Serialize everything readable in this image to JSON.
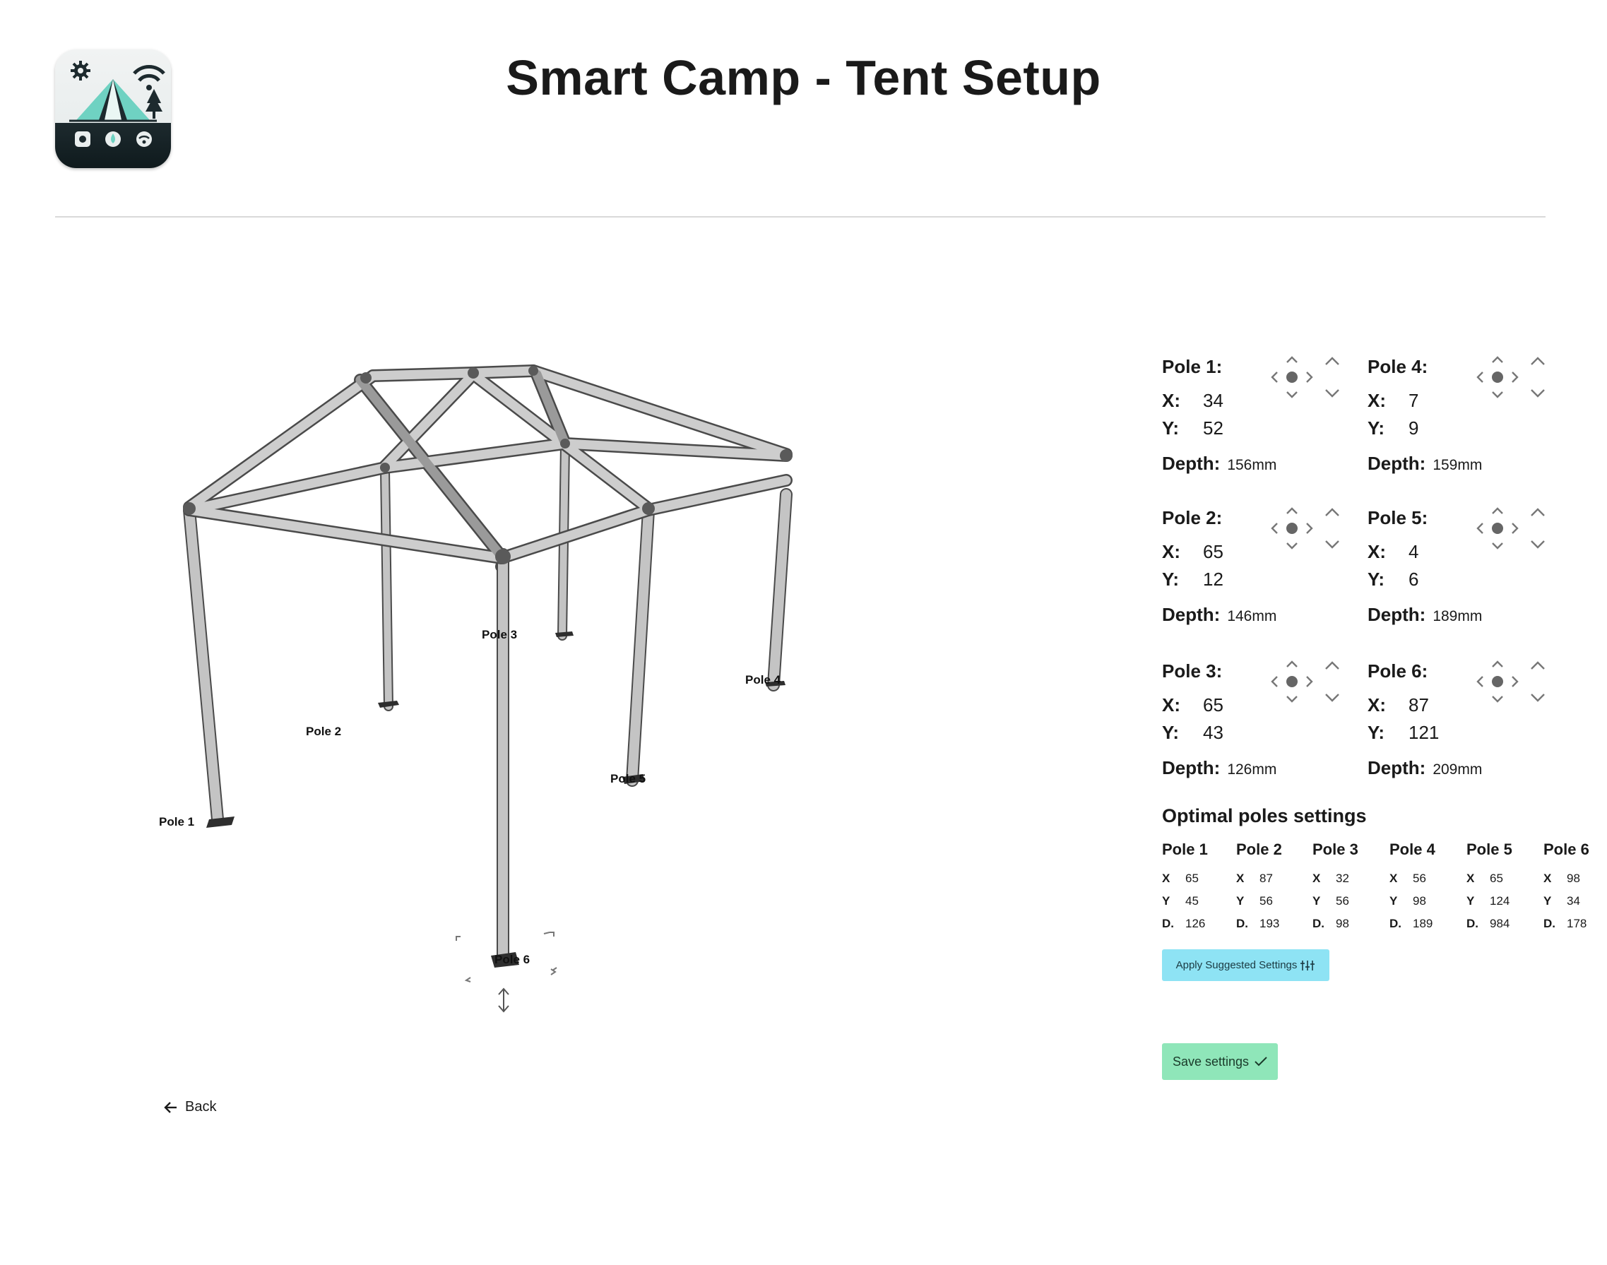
{
  "header": {
    "title": "Smart Camp - Tent Setup"
  },
  "tent_labels": [
    "Pole 1",
    "Pole 2",
    "Pole 3",
    "Pole 4",
    "Pole 5",
    "Pole 6"
  ],
  "poles": [
    {
      "name": "Pole 1:",
      "x_label": "X:",
      "x": "34",
      "y_label": "Y:",
      "y": "52",
      "depth_label": "Depth:",
      "depth": "156mm"
    },
    {
      "name": "Pole 4:",
      "x_label": "X:",
      "x": "7",
      "y_label": "Y:",
      "y": "9",
      "depth_label": "Depth:",
      "depth": "159mm"
    },
    {
      "name": "Pole 2:",
      "x_label": "X:",
      "x": "65",
      "y_label": "Y:",
      "y": "12",
      "depth_label": "Depth:",
      "depth": "146mm"
    },
    {
      "name": "Pole 5:",
      "x_label": "X:",
      "x": "4",
      "y_label": "Y:",
      "y": "6",
      "depth_label": "Depth:",
      "depth": "189mm"
    },
    {
      "name": "Pole 3:",
      "x_label": "X:",
      "x": "65",
      "y_label": "Y:",
      "y": "43",
      "depth_label": "Depth:",
      "depth": "126mm"
    },
    {
      "name": "Pole 6:",
      "x_label": "X:",
      "x": "87",
      "y_label": "Y:",
      "y": "121",
      "depth_label": "Depth:",
      "depth": "209mm"
    }
  ],
  "optimal": {
    "title": "Optimal poles settings",
    "columns": [
      {
        "name": "Pole 1",
        "x": "65",
        "y": "45",
        "d": "126"
      },
      {
        "name": "Pole 2",
        "x": "87",
        "y": "56",
        "d": "193"
      },
      {
        "name": "Pole 3",
        "x": "32",
        "y": "56",
        "d": "98"
      },
      {
        "name": "Pole 4",
        "x": "56",
        "y": "98",
        "d": "189"
      },
      {
        "name": "Pole 5",
        "x": "65",
        "y": "124",
        "d": "984"
      },
      {
        "name": "Pole 6",
        "x": "98",
        "y": "34",
        "d": "178"
      }
    ],
    "labels": {
      "x": "X",
      "y": "Y",
      "d": "D."
    }
  },
  "actions": {
    "apply_label": "Apply Suggested Settings",
    "save_label": "Save settings",
    "back_label": "Back"
  },
  "icons": {
    "logo": "smart-camp-logo",
    "joystick": "direction-pad-icon",
    "updown": "up-down-arrows-icon",
    "apply": "sliders-icon",
    "save": "checkmark-icon",
    "back": "arrow-left-icon",
    "resize": "vertical-resize-icon"
  },
  "colors": {
    "apply_button": "#8ee3f4",
    "save_button": "#8fe6b9",
    "pole_metal": "#b8b8b8"
  }
}
